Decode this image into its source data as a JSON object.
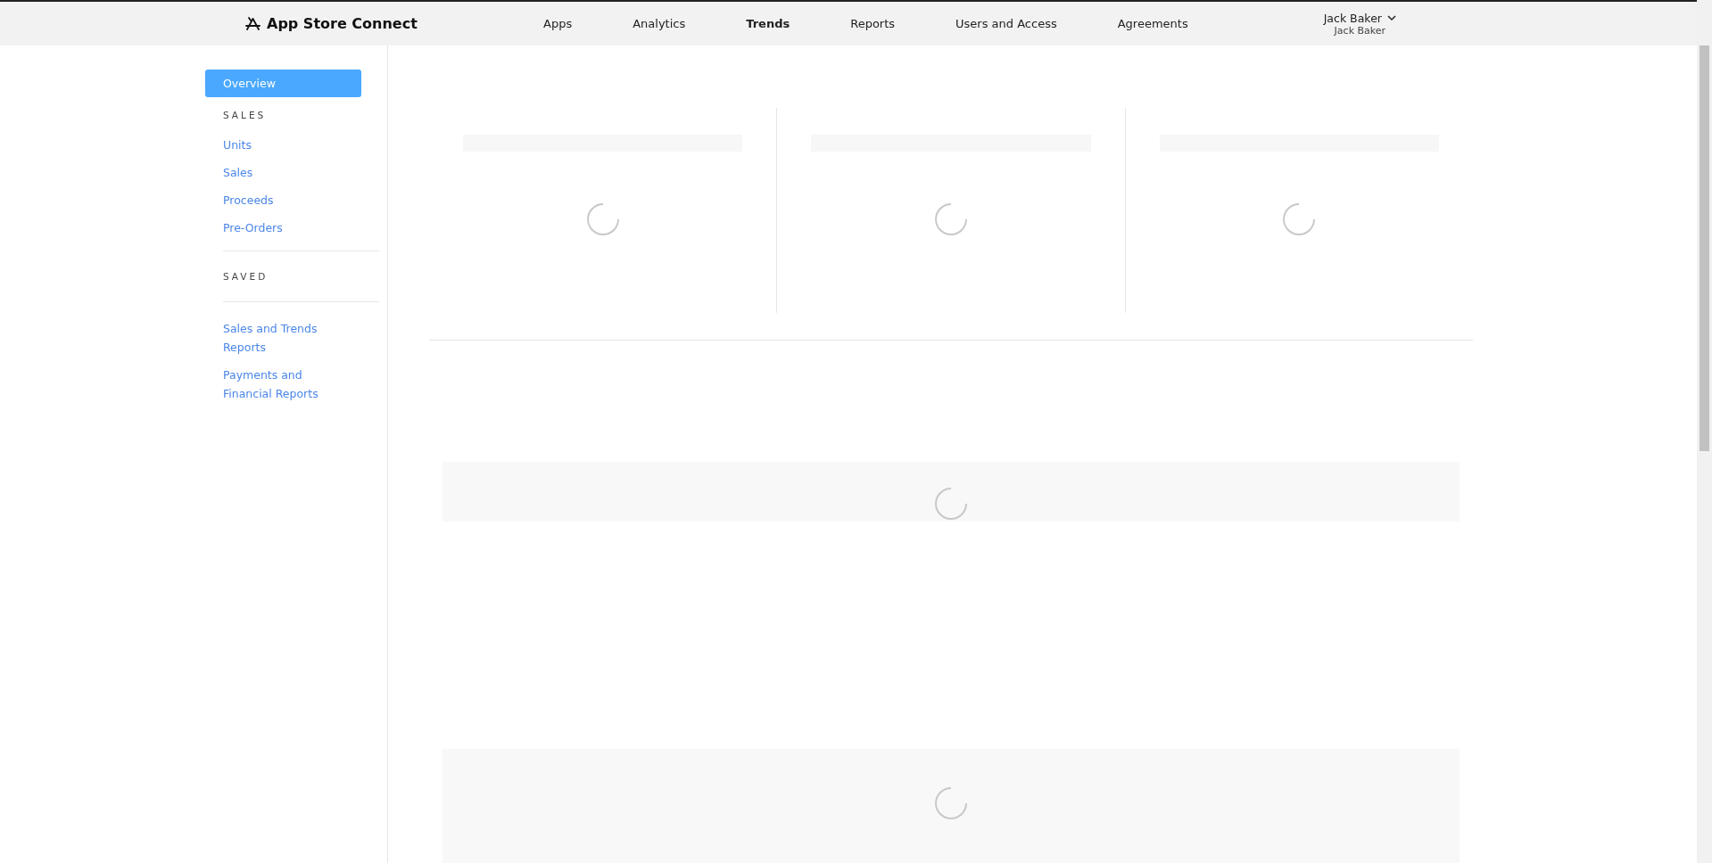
{
  "header": {
    "logo": "App Store Connect",
    "nav": [
      {
        "label": "Apps",
        "selected": false
      },
      {
        "label": "Analytics",
        "selected": false
      },
      {
        "label": "Trends",
        "selected": true
      },
      {
        "label": "Reports",
        "selected": false
      },
      {
        "label": "Users and Access",
        "selected": false
      },
      {
        "label": "Agreements",
        "selected": false
      }
    ],
    "user": {
      "name": "Jack Baker",
      "team": "Jack Baker"
    }
  },
  "sidebar": {
    "items": [
      {
        "kind": "link",
        "label": "Overview",
        "selected": true
      },
      {
        "kind": "heading",
        "label": "SALES"
      },
      {
        "kind": "link",
        "label": "Units",
        "selected": false
      },
      {
        "kind": "link",
        "label": "Sales",
        "selected": false
      },
      {
        "kind": "link",
        "label": "Proceeds",
        "selected": false
      },
      {
        "kind": "link",
        "label": "Pre-Orders",
        "selected": false
      },
      {
        "kind": "divider"
      },
      {
        "kind": "heading",
        "label": "SAVED"
      },
      {
        "kind": "divider"
      },
      {
        "kind": "link",
        "label": "Sales and Trends Reports",
        "selected": false
      },
      {
        "kind": "link",
        "label": "Payments and Financial Reports",
        "selected": false
      }
    ]
  },
  "summary_cards": [
    {
      "loading": true
    },
    {
      "loading": true
    },
    {
      "loading": true
    }
  ],
  "panels": [
    {
      "loading": true
    },
    {
      "loading": true
    }
  ]
}
